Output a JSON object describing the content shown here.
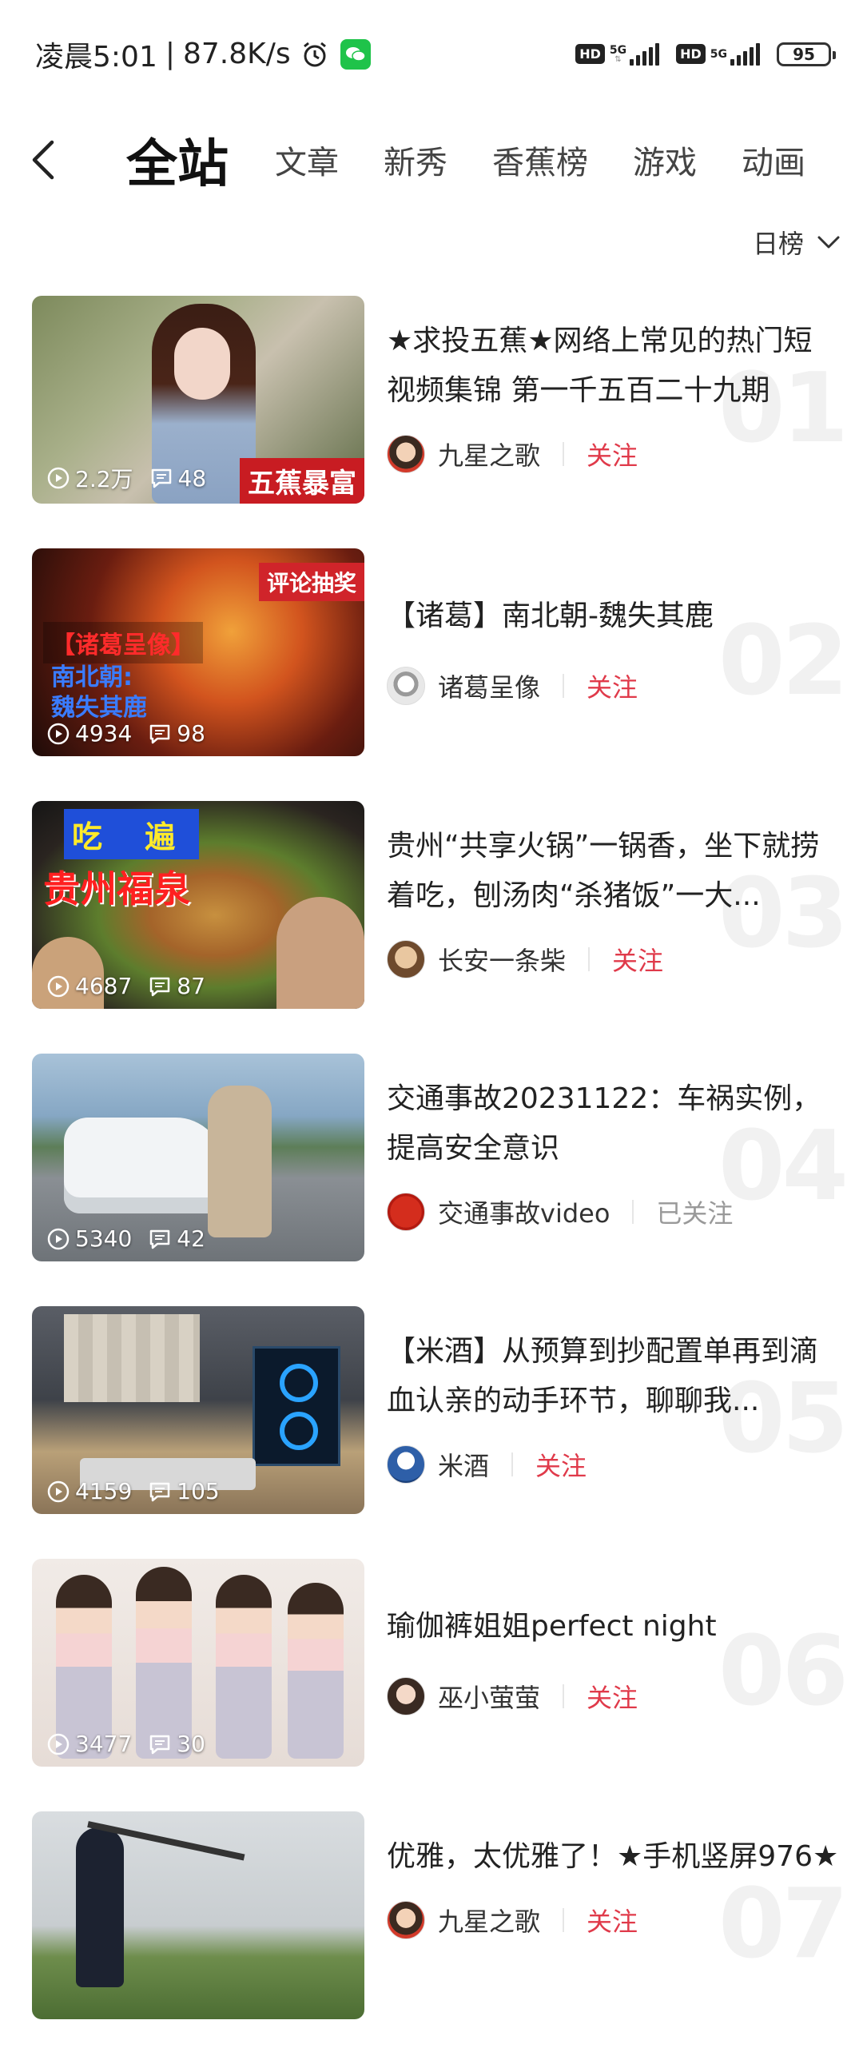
{
  "status_bar": {
    "time": "凌晨5:01",
    "speed": "87.8K/s",
    "hd1": "HD",
    "net1": "5G",
    "hd2": "HD",
    "net2": "5G",
    "battery": "95"
  },
  "nav": {
    "tabs": [
      {
        "label": "全站"
      },
      {
        "label": "文章"
      },
      {
        "label": "新秀"
      },
      {
        "label": "香蕉榜"
      },
      {
        "label": "游戏"
      },
      {
        "label": "动画"
      }
    ]
  },
  "sort": {
    "label": "日榜"
  },
  "items": [
    {
      "title": "★求投五蕉★网络上常见的热门短视频集锦 第一千五百二十九期",
      "plays": "2.2万",
      "comments": "48",
      "author": "九星之歌",
      "follow": "关注",
      "rank": "01",
      "tag": "五蕉暴富"
    },
    {
      "title": "【诸葛】南北朝-魏失其鹿",
      "plays": "4934",
      "comments": "98",
      "author": "诸葛呈像",
      "follow": "关注",
      "rank": "02",
      "tag": "评论抽奖",
      "tag2": "【诸葛呈像】",
      "tag3": "南北朝:",
      "tag4": "魏失其鹿"
    },
    {
      "title": "贵州“共享火锅”一锅香，坐下就捞着吃，刨汤肉“杀猪饭”一大...",
      "plays": "4687",
      "comments": "87",
      "author": "长安一条柴",
      "follow": "关注",
      "rank": "03",
      "tag": "吃 遍",
      "tag2": "贵州福泉"
    },
    {
      "title": "交通事故20231122：车祸实例，提高安全意识",
      "plays": "5340",
      "comments": "42",
      "author": "交通事故video",
      "follow": "已关注",
      "rank": "04"
    },
    {
      "title": "【米酒】从预算到抄配置单再到滴血认亲的动手环节，聊聊我...",
      "plays": "4159",
      "comments": "105",
      "author": "米酒",
      "follow": "关注",
      "rank": "05"
    },
    {
      "title": "瑜伽裤姐姐perfect night",
      "plays": "3477",
      "comments": "30",
      "author": "巫小萤萤",
      "follow": "关注",
      "rank": "06"
    },
    {
      "title": "优雅，太优雅了！★手机竖屏976★",
      "plays": "",
      "comments": "",
      "author": "九星之歌",
      "follow": "关注",
      "rank": "07"
    }
  ],
  "colors": {
    "accent": "#e03a4a",
    "followed": "#999999"
  }
}
